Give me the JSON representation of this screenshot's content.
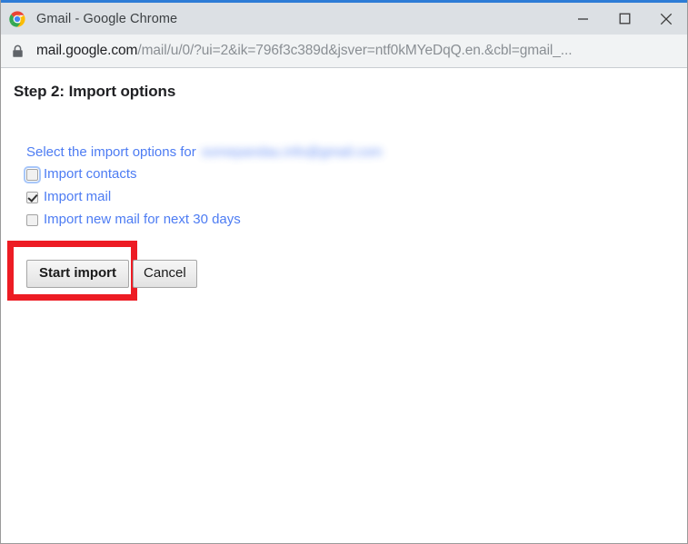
{
  "window": {
    "title": "Gmail - Google Chrome",
    "app_icon": "chrome-logo-icon",
    "controls": {
      "minimize": "minimize-icon",
      "maximize": "maximize-icon",
      "close": "close-icon"
    },
    "accent_color": "#2e7cd6",
    "titlebar_color": "#dce0e4"
  },
  "toolbar": {
    "security_icon": "lock-icon",
    "url_host": "mail.google.com",
    "url_path": "/mail/u/0/?ui=2&ik=796f3c389d&jsver=ntf0kMYeDqQ.en.&cbl=gmail_...",
    "url_full": "mail.google.com/mail/u/0/?ui=2&ik=796f3c389d&jsver=ntf0kMYeDqQ.en.&cbl=gmail_..."
  },
  "page": {
    "title": "Step 2: Import options",
    "intro_text": "Select the import options for",
    "account_email_redacted": "somepandau.info@gmail.com",
    "link_color": "#4d7cf3",
    "options": [
      {
        "label": "Import contacts",
        "checked": false,
        "focused": true
      },
      {
        "label": "Import mail",
        "checked": true,
        "focused": false
      },
      {
        "label": "Import new mail for next 30 days",
        "checked": false,
        "focused": false
      }
    ],
    "buttons": {
      "primary": "Start import",
      "secondary": "Cancel"
    }
  },
  "annotation": {
    "color": "#ed1c24",
    "target": "Start import"
  }
}
